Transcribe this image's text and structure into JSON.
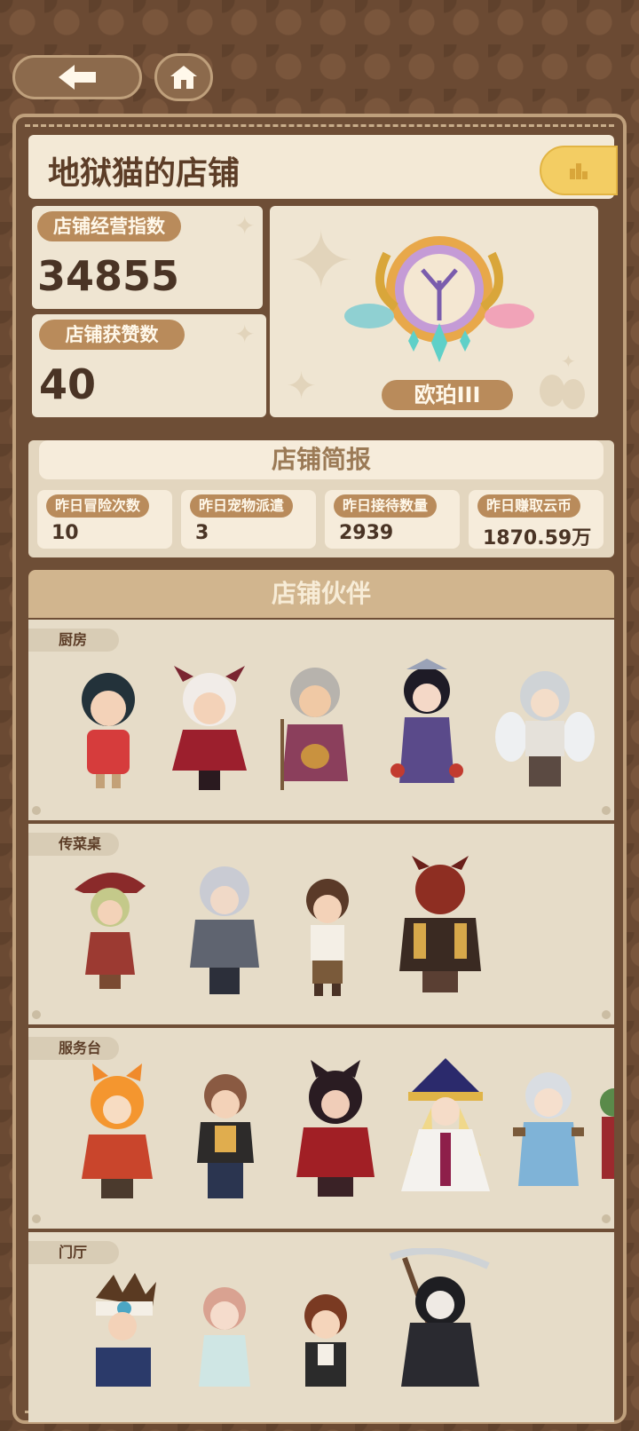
{
  "shop_name": "地狱猫的店铺",
  "stats": {
    "business_label": "店铺经营指数",
    "business_value": "34855",
    "likes_label": "店铺获赞数",
    "likes_value": "40"
  },
  "badge": {
    "rank_label": "欧珀III"
  },
  "report": {
    "title": "店铺简报",
    "items": [
      {
        "label": "昨日冒险次数",
        "value": "10"
      },
      {
        "label": "昨日宠物派遣",
        "value": "3"
      },
      {
        "label": "昨日接待数量",
        "value": "2939"
      },
      {
        "label": "昨日赚取云币",
        "value": "1870.59万"
      }
    ]
  },
  "partners": {
    "title": "店铺伙伴",
    "sections": [
      {
        "label": "厨房",
        "characters": [
          "girl-red-hoodie",
          "horned-girl-red-dress",
          "old-witch",
          "dark-princess",
          "white-haired-angel"
        ]
      },
      {
        "label": "传菜桌",
        "characters": [
          "red-hat-witch",
          "silver-knight",
          "brown-hair-boy",
          "red-demon"
        ]
      },
      {
        "label": "服务台",
        "characters": [
          "orange-cat-girl",
          "casual-boy",
          "crimson-armor-girl",
          "sorceress-blue-hat",
          "white-haired-kimono-girl",
          "green-haired-edge"
        ]
      },
      {
        "label": "门厅",
        "characters": [
          "goggles-boy",
          "pink-hair-girl",
          "auburn-girl",
          "grim-reaper"
        ]
      }
    ]
  },
  "colors": {
    "brand_brown": "#6b4a33",
    "panel": "#efe5d2",
    "pill": "#b98b5b",
    "gold": "#f3cd63"
  },
  "icons": {
    "back": "arrow-left-icon",
    "home": "home-icon",
    "rank": "bar-chart-icon"
  }
}
